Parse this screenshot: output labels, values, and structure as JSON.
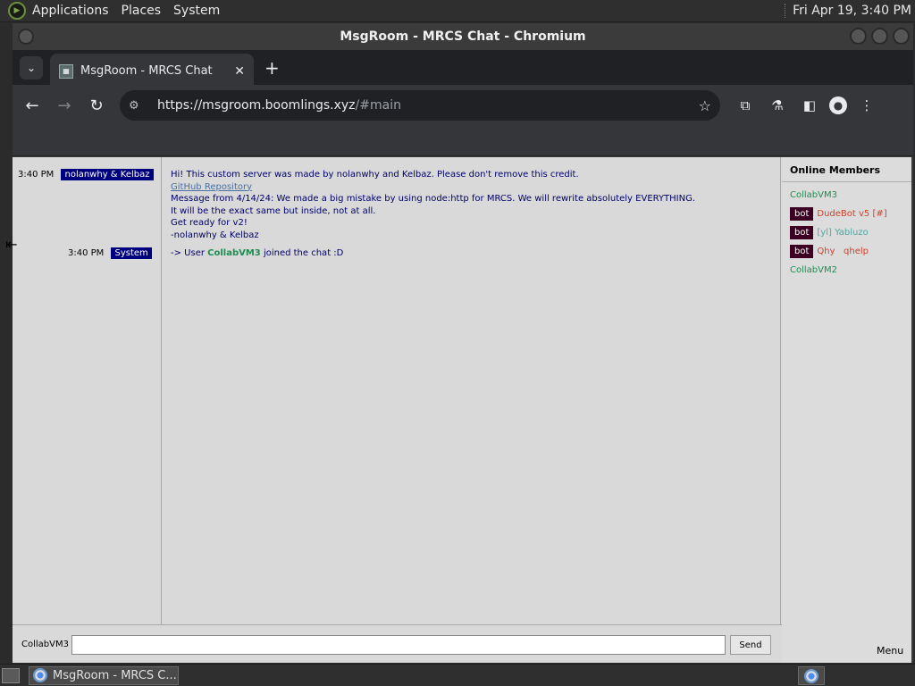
{
  "desktop": {
    "menu": [
      "Applications",
      "Places",
      "System"
    ],
    "clock": "Fri Apr 19,  3:40 PM"
  },
  "window": {
    "title": "MsgRoom - MRCS Chat - Chromium"
  },
  "browser": {
    "tab_title": "MsgRoom - MRCS Chat",
    "url_host": "https://msgroom.boomlings.xyz",
    "url_rest": "/#main"
  },
  "chat": {
    "messages": [
      {
        "time": "3:40 PM",
        "sender": "nolanwhy & Kelbaz",
        "lines": [
          "Hi! This custom server was made by nolanwhy and Kelbaz. Please don't remove this credit.",
          "GitHub Repository",
          "Message from 4/14/24: We made a big mistake by using node:http for MRCS. We will rewrite absolutely EVERYTHING.",
          "It will be the exact same but inside, not at all.",
          "Get ready for v2!",
          "-nolanwhy & Kelbaz"
        ]
      },
      {
        "time": "3:40 PM",
        "sender": "System",
        "prefix": "-> User ",
        "user": "CollabVM3",
        "suffix": " joined the chat :D"
      }
    ],
    "nick": "CollabVM3",
    "input_value": "",
    "send_label": "Send",
    "menu_label": "Menu"
  },
  "members": {
    "title": "Online Members",
    "list": [
      {
        "badge": "",
        "name": "CollabVM3",
        "color": "#1e8d52"
      },
      {
        "badge": "bot",
        "name": "DudeBot v5 [#]",
        "color": "#d0402a"
      },
      {
        "badge": "bot",
        "name": "[yl] Yabluzo",
        "color": "#4fa7a0"
      },
      {
        "badge": "bot",
        "name": "Qhy   qhelp",
        "color": "#d0402a"
      },
      {
        "badge": "",
        "name": "CollabVM2",
        "color": "#1e8d52"
      }
    ]
  },
  "taskbar": {
    "task_label": "MsgRoom - MRCS C..."
  },
  "colors": {
    "name_badge_bg": "#00007f",
    "bot_badge_bg": "#3d0022",
    "message_text": "#00006a",
    "page_bg": "#d9d9d9"
  }
}
